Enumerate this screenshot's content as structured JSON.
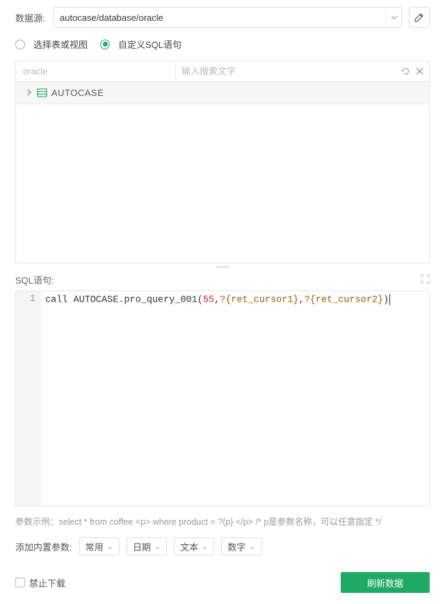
{
  "datasource": {
    "label": "数据源:",
    "value": "autocase/database/oracle"
  },
  "mode": {
    "option1": "选择表或视图",
    "option2": "自定义SQL语句",
    "selected": 1
  },
  "tree": {
    "title": "oracle",
    "search_placeholder": "输入搜索文字",
    "root": "AUTOCASE"
  },
  "sql": {
    "label": "SQL语句:",
    "line_no": "1",
    "tokens": {
      "call": "call ",
      "ident": "AUTOCASE.pro_query_001",
      "open": "(",
      "num": "55",
      "c1": ",",
      "p1": "?{ret_cursor1}",
      "c2": ",",
      "p2": "?{ret_cursor2}",
      "close": ")"
    },
    "hint": "参数示例：select * from coffee <p> where product = ?{p} </p>  /* p是参数名称，可以任意指定 */"
  },
  "params": {
    "label": "添加内置参数:",
    "dd1": "常用",
    "dd2": "日期",
    "dd3": "文本",
    "dd4": "数字"
  },
  "footer": {
    "forbid_download": "禁止下载",
    "refresh": "刷新数据"
  }
}
